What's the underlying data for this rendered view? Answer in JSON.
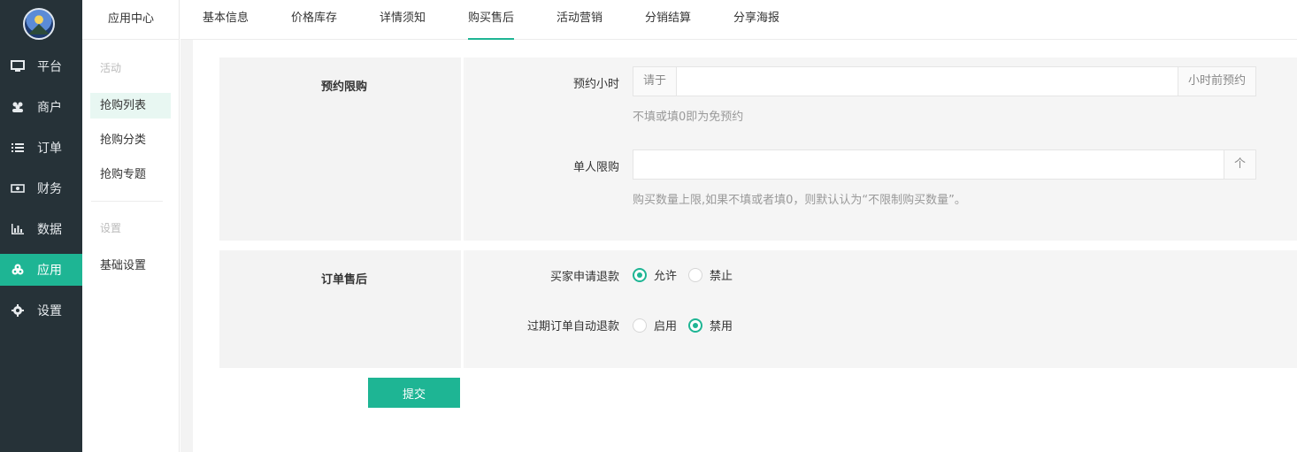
{
  "nav": {
    "items": [
      {
        "label": "平台",
        "icon": "monitor-icon"
      },
      {
        "label": "商户",
        "icon": "users-icon"
      },
      {
        "label": "订单",
        "icon": "list-icon"
      },
      {
        "label": "财务",
        "icon": "money-icon"
      },
      {
        "label": "数据",
        "icon": "bar-chart-icon"
      },
      {
        "label": "应用",
        "icon": "cubes-icon",
        "active": true
      },
      {
        "label": "设置",
        "icon": "gear-icon"
      }
    ]
  },
  "submenu": {
    "title": "应用中心",
    "group_activity": "活动",
    "links": [
      "抢购列表",
      "抢购分类",
      "抢购专题"
    ],
    "group_settings": "设置",
    "settings_link": "基础设置"
  },
  "tabs": [
    "基本信息",
    "价格库存",
    "详情须知",
    "购买售后",
    "活动营销",
    "分销结算",
    "分享海报"
  ],
  "active_tab": "购买售后",
  "section_reserve": {
    "title": "预约限购",
    "reserve_hours_label": "预约小时",
    "reserve_prefix": "请于",
    "reserve_value": "",
    "reserve_suffix": "小时前预约",
    "reserve_help": "不填或填0即为免预约",
    "limit_label": "单人限购",
    "limit_value": "",
    "limit_suffix": "个",
    "limit_help": "购买数量上限,如果不填或者填0，则默认认为“不限制购买数量”。"
  },
  "section_aftersale": {
    "title": "订单售后",
    "refund_label": "买家申请退款",
    "refund_options": [
      "允许",
      "禁止"
    ],
    "refund_selected": "允许",
    "auto_refund_label": "过期订单自动退款",
    "auto_refund_options": [
      "启用",
      "禁用"
    ],
    "auto_refund_selected": "禁用"
  },
  "submit_label": "提交",
  "colors": {
    "accent": "#1eb594",
    "nav_bg": "#263238"
  }
}
